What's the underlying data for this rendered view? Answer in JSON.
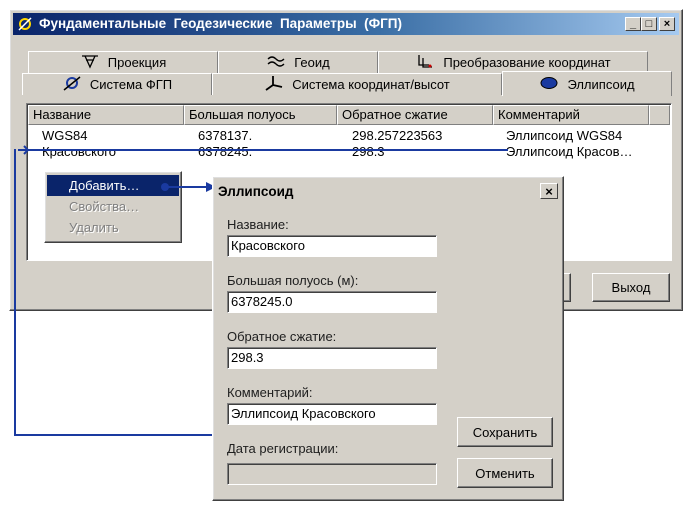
{
  "main_window": {
    "title": "Фундаментальные  Геодезические  Параметры  (ФГП)",
    "caption_buttons": {
      "minimize": "_",
      "maximize": "□",
      "close": "×"
    },
    "tabs_row1": [
      {
        "label": "Проекция",
        "icon": "projection-icon"
      },
      {
        "label": "Геоид",
        "icon": "geoid-icon"
      },
      {
        "label": "Преобразование координат",
        "icon": "coordinate-transform-icon"
      }
    ],
    "tabs_row2": [
      {
        "label": "Система ФГП",
        "icon": "fgp-system-icon"
      },
      {
        "label": "Система координат/высот",
        "icon": "coordinate-axes-icon"
      },
      {
        "label": "Эллипсоид",
        "icon": "ellipsoid-icon",
        "selected": true
      }
    ],
    "table": {
      "columns": [
        "Название",
        "Большая полуось",
        "Обратное сжатие",
        "Комментарий"
      ],
      "rows": [
        [
          "WGS84",
          "6378137.",
          "298.257223563",
          "Эллипсоид WGS84"
        ],
        [
          "Красовского",
          "6378245.",
          "298.3",
          "Эллипсоид Красов…"
        ]
      ]
    },
    "exit_button": "Выход"
  },
  "context_menu": {
    "items": [
      {
        "label": "Добавить…",
        "enabled": true,
        "highlighted": true
      },
      {
        "label": "Свойства…",
        "enabled": false
      },
      {
        "label": "Удалить",
        "enabled": false
      }
    ]
  },
  "dialog": {
    "title": "Эллипсоид",
    "close": "×",
    "fields": {
      "name_label": "Название:",
      "name_value": "Красовского",
      "semi_major_label": "Большая полуось (м):",
      "semi_major_value": "6378245.0",
      "inverse_flattening_label": "Обратное сжатие:",
      "inverse_flattening_value": "298.3",
      "comment_label": "Комментарий:",
      "comment_value": "Эллипсоид Красовского",
      "registration_date_label": "Дата регистрации:",
      "registration_date_value": ""
    },
    "save_button": "Сохранить",
    "cancel_button": "Отменить"
  },
  "colors": {
    "titlebar_start": "#0a246a",
    "titlebar_end": "#a6caf0",
    "face": "#d4d0c8",
    "highlight": "#0a246a",
    "connector": "#1a3aa0"
  }
}
